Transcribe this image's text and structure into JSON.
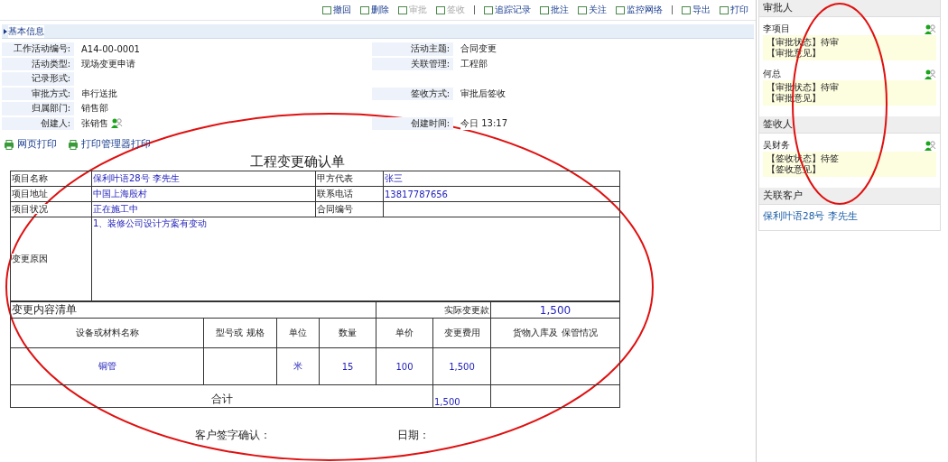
{
  "toolbar": [
    {
      "label": "撤回",
      "disabled": false
    },
    {
      "label": "删除",
      "disabled": false
    },
    {
      "label": "审批",
      "disabled": true
    },
    {
      "label": "签收",
      "disabled": true
    },
    {
      "label": "追踪记录",
      "disabled": false
    },
    {
      "label": "批注",
      "disabled": false
    },
    {
      "label": "关注",
      "disabled": false
    },
    {
      "label": "监控网络",
      "disabled": false
    },
    {
      "label": "导出",
      "disabled": false
    },
    {
      "label": "打印",
      "disabled": false
    }
  ],
  "basic_info": {
    "title": "基本信息",
    "rows": [
      {
        "left": {
          "label": "工作活动编号:",
          "value": "A14-00-0001"
        },
        "right": {
          "label": "活动主题:",
          "value": "合同变更"
        }
      },
      {
        "left": {
          "label": "活动类型:",
          "value": "现场变更申请"
        },
        "right": {
          "label": "关联管理:",
          "value": "工程部"
        }
      },
      {
        "left": {
          "label": "记录形式:"
        },
        "right": null
      },
      {
        "left": {
          "label": "审批方式:",
          "value": "串行送批"
        },
        "right": {
          "label": "签收方式:",
          "value": "审批后签收"
        }
      },
      {
        "left": {
          "label": "归属部门:",
          "value": "销售部"
        },
        "right": null
      },
      {
        "left": {
          "label": "创建人:",
          "value": "张销售",
          "person": true
        },
        "right": {
          "label": "创建时间:",
          "value": "今日 13:17"
        }
      }
    ]
  },
  "print_links": [
    "网页打印",
    "打印管理器打印"
  ],
  "form": {
    "title": "工程变更确认单",
    "header_rows": [
      {
        "label": "项目名称",
        "value": "保利叶语28号 李先生",
        "label_2": "甲方代表",
        "value_2": "张三"
      },
      {
        "label": "项目地址",
        "value": "中国上海殷村",
        "label_2": "联系电话",
        "value_2": "13817787656"
      },
      {
        "label": "项目状况",
        "value": "正在施工中",
        "label_2": "合同编号",
        "value_2": ""
      }
    ],
    "reason": {
      "label": "变更原因",
      "value": "1、装修公司设计方案有变动"
    },
    "list_title": "变更内容清单",
    "actual_label": "实际变更款",
    "actual_value": "1,500",
    "columns": [
      "设备或材料名称",
      "型号或 规格",
      "单位",
      "数量",
      "单价",
      "变更费用",
      "货物入库及 保管情况"
    ],
    "rows": [
      [
        "铜管",
        "",
        "米",
        "15",
        "100",
        "1,500",
        ""
      ]
    ],
    "total_label": "合计",
    "total_value": "1,500",
    "signature_label": "客户签字确认：",
    "date_label": "日期："
  },
  "sidebar": {
    "sections": [
      {
        "title": "审批人",
        "kind": "people",
        "people": [
          {
            "name": "李项目",
            "status": "【审批状态】待审",
            "opinion": "【审批意见】"
          },
          {
            "name": "何总",
            "status": "【审批状态】待审",
            "opinion": "【审批意见】"
          }
        ]
      },
      {
        "title": "签收人",
        "kind": "people",
        "people": [
          {
            "name": "吴财务",
            "status": "【签收状态】待签",
            "opinion": "【签收意见】"
          }
        ]
      },
      {
        "title": "关联客户",
        "kind": "link",
        "link": "保利叶语28号 李先生"
      }
    ]
  }
}
